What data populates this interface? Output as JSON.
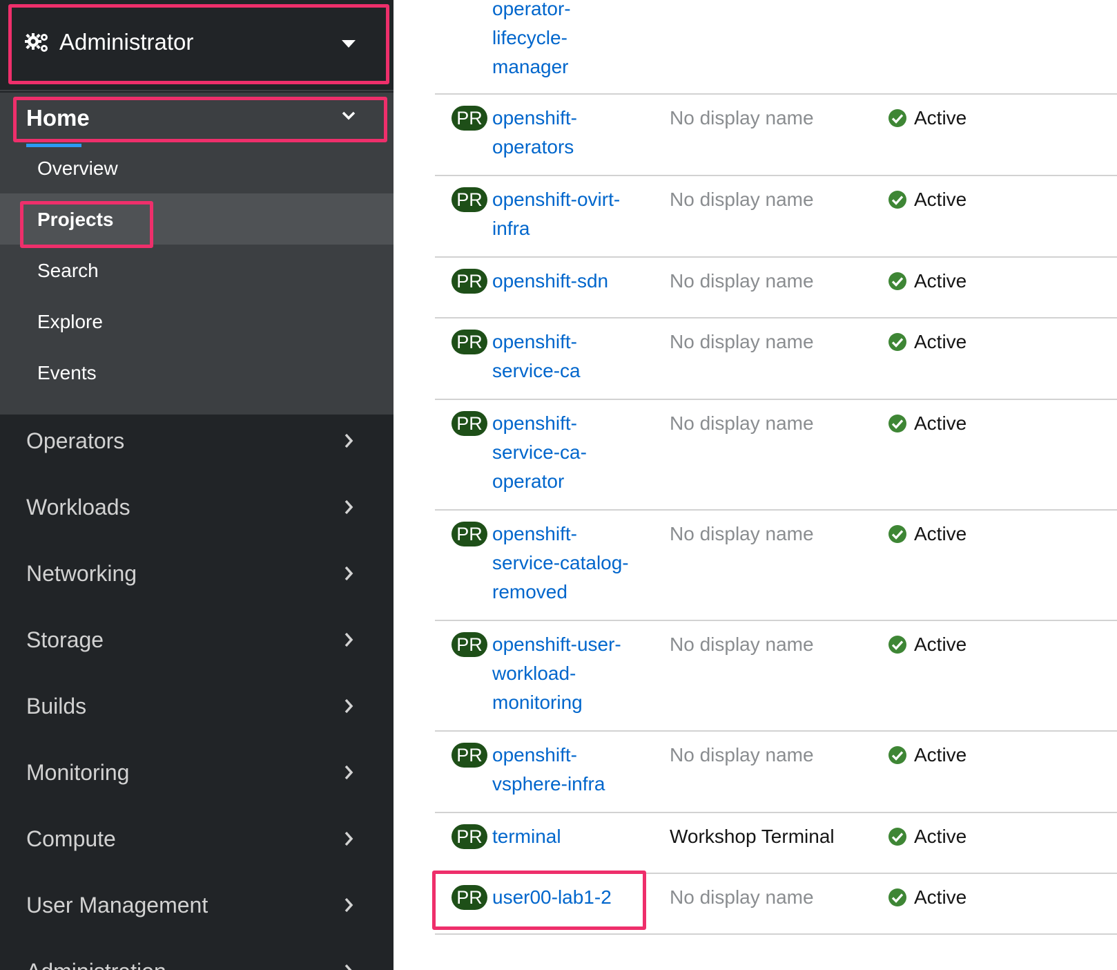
{
  "perspective": {
    "title": "Administrator",
    "icon": "gears-icon"
  },
  "home": {
    "label": "Home",
    "items": [
      {
        "label": "Overview",
        "active": false
      },
      {
        "label": "Projects",
        "active": true
      },
      {
        "label": "Search",
        "active": false
      },
      {
        "label": "Explore",
        "active": false
      },
      {
        "label": "Events",
        "active": false
      }
    ]
  },
  "nav": [
    {
      "label": "Operators"
    },
    {
      "label": "Workloads"
    },
    {
      "label": "Networking"
    },
    {
      "label": "Storage"
    },
    {
      "label": "Builds"
    },
    {
      "label": "Monitoring"
    },
    {
      "label": "Compute"
    },
    {
      "label": "User Management"
    },
    {
      "label": "Administration"
    }
  ],
  "projects": {
    "badge": "PR",
    "partial_name_lines": [
      "operator-",
      "lifecycle-",
      "manager"
    ],
    "rows": [
      {
        "name_lines": [
          "openshift-",
          "operators"
        ],
        "display": "No display name",
        "status": "Active"
      },
      {
        "name_lines": [
          "openshift-ovirt-",
          "infra"
        ],
        "display": "No display name",
        "status": "Active"
      },
      {
        "name_lines": [
          "openshift-sdn"
        ],
        "display": "No display name",
        "status": "Active"
      },
      {
        "name_lines": [
          "openshift-",
          "service-ca"
        ],
        "display": "No display name",
        "status": "Active"
      },
      {
        "name_lines": [
          "openshift-",
          "service-ca-",
          "operator"
        ],
        "display": "No display name",
        "status": "Active"
      },
      {
        "name_lines": [
          "openshift-",
          "service-catalog-",
          "removed"
        ],
        "display": "No display name",
        "status": "Active"
      },
      {
        "name_lines": [
          "openshift-user-",
          "workload-",
          "monitoring"
        ],
        "display": "No display name",
        "status": "Active"
      },
      {
        "name_lines": [
          "openshift-",
          "vsphere-infra"
        ],
        "display": "No display name",
        "status": "Active"
      },
      {
        "name_lines": [
          "terminal"
        ],
        "display": "Workshop Terminal",
        "status": "Active"
      },
      {
        "name_lines": [
          "user00-lab1-2"
        ],
        "display": "No display name",
        "status": "Active"
      }
    ]
  },
  "colors": {
    "sidebar_bg": "#212427",
    "home_bg": "#3c3f42",
    "active_bg": "#4f5255",
    "link": "#0066cc",
    "badge_bg": "#1e4f18",
    "status_green": "#3e8635",
    "highlight": "#ee2f6b"
  }
}
